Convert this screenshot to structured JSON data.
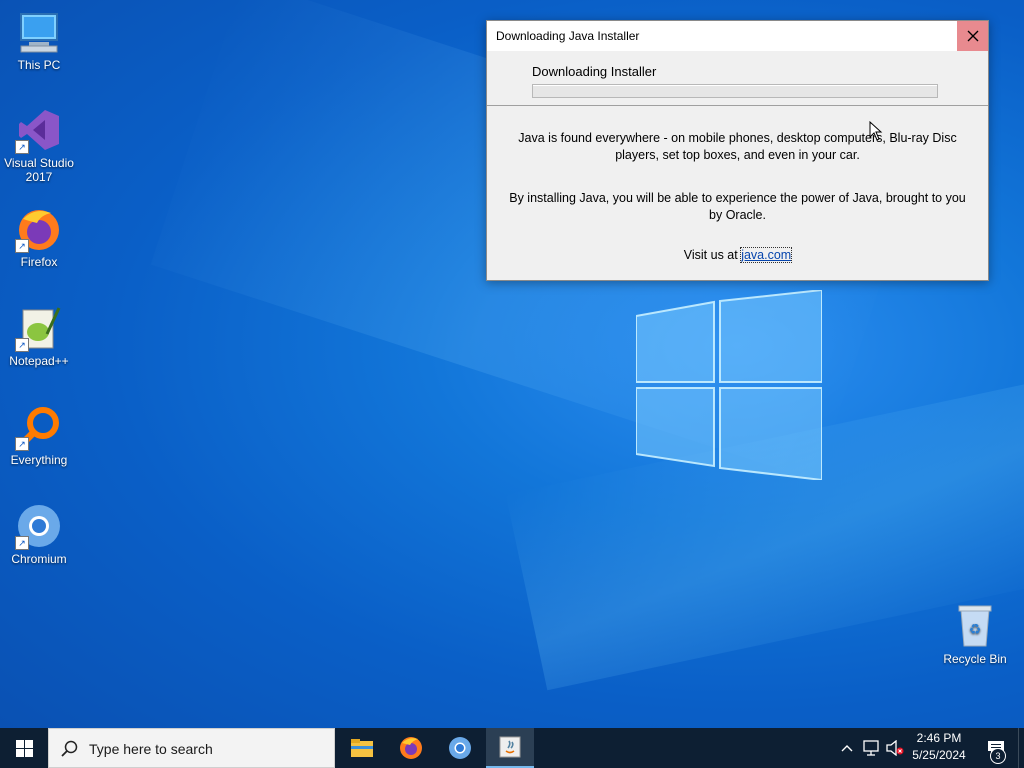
{
  "desktop": {
    "icons": [
      {
        "label": "This PC",
        "icon": "this-pc-icon"
      },
      {
        "label": "Visual Studio 2017",
        "icon": "visual-studio-icon"
      },
      {
        "label": "Firefox",
        "icon": "firefox-icon"
      },
      {
        "label": "Notepad++",
        "icon": "notepad-plus-plus-icon"
      },
      {
        "label": "Everything",
        "icon": "everything-icon"
      },
      {
        "label": "Chromium",
        "icon": "chromium-icon"
      },
      {
        "label": "Recycle Bin",
        "icon": "recycle-bin-icon"
      }
    ]
  },
  "dialog": {
    "title": "Downloading Java Installer",
    "status_label": "Downloading Installer",
    "progress_percent": 0,
    "paragraph1": "Java is found everywhere - on mobile phones, desktop computers, Blu-ray Disc players, set top boxes, and even in your car.",
    "paragraph2": "By installing Java, you will be able to experience the power of Java, brought to you by Oracle.",
    "visit_prefix": "Visit us at ",
    "visit_link": "java.com"
  },
  "taskbar": {
    "search_placeholder": "Type here to search",
    "apps": [
      "file-explorer-icon",
      "firefox-icon",
      "chromium-icon",
      "java-installer-icon"
    ],
    "clock_time": "2:46 PM",
    "clock_date": "5/25/2024",
    "notification_count": "3"
  },
  "colors": {
    "close_button_hover": "#e88a8f",
    "taskbar_bg": "#0d1f33",
    "link": "#0645ad"
  }
}
